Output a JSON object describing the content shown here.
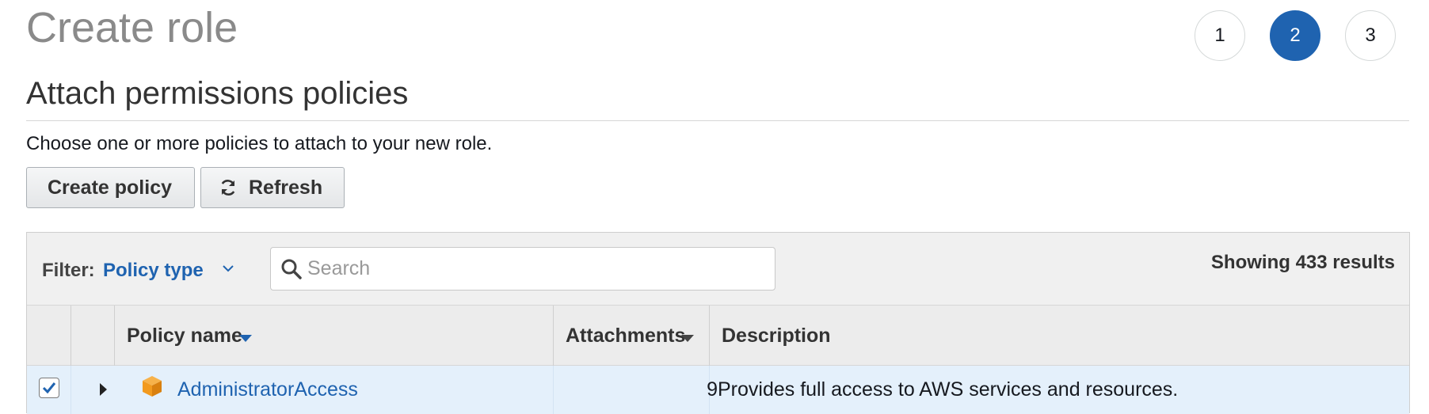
{
  "page": {
    "title": "Create role"
  },
  "wizard": {
    "steps": [
      "1",
      "2",
      "3"
    ],
    "active_step": 2
  },
  "section": {
    "title": "Attach permissions policies",
    "description": "Choose one or more policies to attach to your new role."
  },
  "toolbar": {
    "create_label": "Create policy",
    "refresh_label": "Refresh",
    "refresh_icon": "refresh-icon"
  },
  "filter": {
    "label": "Filter:",
    "value": "Policy type",
    "search_placeholder": "Search",
    "search_value": "",
    "results_text": "Showing 433 results"
  },
  "table": {
    "columns": {
      "policy_name": "Policy name",
      "attachments": "Attachments",
      "description": "Description"
    },
    "rows": [
      {
        "checked": true,
        "name": "AdministratorAccess",
        "attachments": "9",
        "description": "Provides full access to AWS services and resources.",
        "icon": "aws-managed-policy-icon"
      }
    ]
  },
  "colors": {
    "link": "#1f63b0",
    "active_step": "#1f63b0",
    "selected_row": "#e4f0fb",
    "policy_icon": "#f29a1e"
  }
}
